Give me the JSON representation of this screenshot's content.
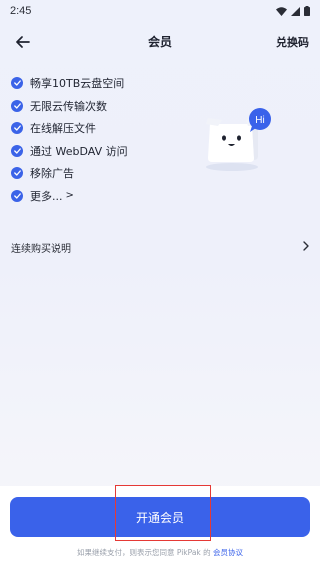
{
  "status_bar": {
    "time": "2:45",
    "icons": [
      "wifi-icon",
      "signal-icon",
      "battery-icon"
    ]
  },
  "header": {
    "title": "会员",
    "redeem_label": "兑换码",
    "back_icon": "arrow-left-icon"
  },
  "benefits": [
    {
      "label": "畅享10TB云盘空间"
    },
    {
      "label": "无限云传输次数"
    },
    {
      "label": "在线解压文件"
    },
    {
      "label": "通过 WebDAV 访问"
    },
    {
      "label": "移除广告"
    },
    {
      "label": "更多..."
    }
  ],
  "mascot": {
    "bubble_text": "Hi"
  },
  "renew_row": {
    "label": "连续购买说明"
  },
  "cta": {
    "label": "开通会员"
  },
  "agreement": {
    "prefix": "如果继续支付，则表示您同意 PikPak 的 ",
    "link": "会员协议"
  },
  "colors": {
    "accent": "#3a62ea",
    "highlight": "#e53935"
  }
}
